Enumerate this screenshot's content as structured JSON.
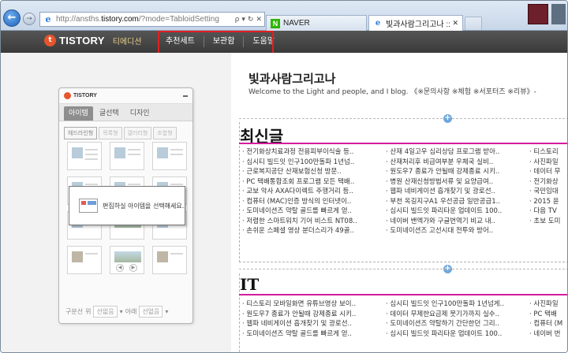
{
  "browser": {
    "url_prefix": "http://ansths.",
    "url_domain": "tistory.com",
    "url_path": "/?mode=TabloidSetting",
    "search_glyph": "ρ",
    "tabs": [
      {
        "label": "NAVER"
      },
      {
        "label": "빛과사람그리고나 ::"
      }
    ]
  },
  "tistory": {
    "brand": "TISTORY",
    "edition": "티에디션",
    "menu": [
      "추천세트",
      "보관함",
      "도움말"
    ]
  },
  "panel": {
    "brand": "TISTORY",
    "tabs": [
      "아이템",
      "글선택",
      "디자인"
    ],
    "subtabs": [
      "헤드라인형",
      "목록형",
      "갤러리형",
      "조합형"
    ],
    "footer_label": "구분선",
    "footer_select1": "선없음",
    "footer_select2": "선없음",
    "footer_sep": "위",
    "footer_sep2": "아래",
    "tooltip": "편집하실 아이템을 선택해세요."
  },
  "blog": {
    "title": "빛과사람그리고나",
    "subtitle": "Welcome to the Light and people, and I blog. 《※문의사항 ※체험 ※서포터즈 ※리뷰》-",
    "sections": [
      {
        "title": "최신글",
        "columns": [
          [
            "· 전기화상치료과정 전용피부이식술 등..",
            "· 심시티 빌드잇 인구100만돌파 1년넘..",
            "· 근로복지공단 산재보험신청 방문..",
            "· PC 택배통합조회 프로그램 모든 택배..",
            "· 교보 악사 AXA다이렉트 주행거리 등..",
            "· 컴퓨터 (MAC)인증 방식의 인터넷이..",
            "· 도미네이션즈 약탈 골드를 빠르게 얻..",
            "· 저렴한 스마트워치 기어 비스트 NT08..",
            "· 손쉬운 스페셜 영상 분더스리가 49골.."
          ],
          [
            "· 산재 4일고우 심리상담 프로그램 받아..",
            "· 산재처리후 비급여부분 우체국 실비..",
            "· 원도우7 종료가 안될때 강제종료 시키..",
            "· 병원 산재신청방법서류 및 요양급여..",
            "· 웹파 네비게이션 흡개찾기 및 광로선..",
            "· 부천 옥길지구A1 우선공급 일반공급1..",
            "· 심시티 빌드잇 파리타운 업데이트 100..",
            "· 네이버 밴엑가와 구글번역기 비교 내..",
            "· 도미네이션즈 고선시대 전투와 방어.."
          ],
          [
            "· 티스토리",
            "· 사진파일",
            "· 데이터 무",
            "· 전기화상",
            "· 국민임대",
            "· 2015 윤",
            "· 다음 TV",
            "· 초보 도미"
          ]
        ]
      },
      {
        "title": "IT",
        "columns": [
          [
            "· 티스토리 모바일화면 유튜브영상 보이..",
            "· 원도우7 종료가 안될때 강제종료 시키..",
            "· 웹파 네비게이션 흡개찾기 및 광로선..",
            "· 도미네이션즈 약탈 골드를 빠르게 얻.."
          ],
          [
            "· 심시티 빌드잇 인구100만돌파 1년넘게..",
            "· 데이터 무제한요금제 뭇기가까지 실수..",
            "· 도미네이션즈 약탈하기 간단한던 그리..",
            "· 심시티 빌드잇 파리타운 업데이트 100.."
          ],
          [
            "· 사진파일",
            "· PC 택배",
            "· 컴퓨터 (M",
            "· 네이버 번"
          ]
        ]
      }
    ]
  }
}
